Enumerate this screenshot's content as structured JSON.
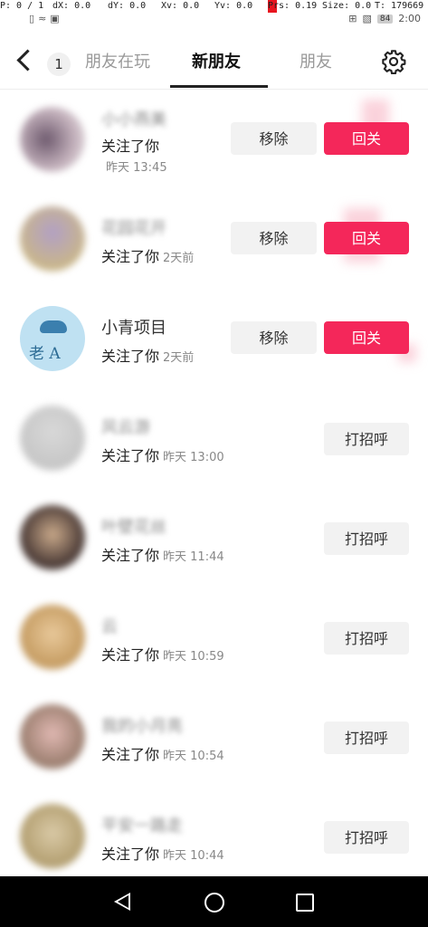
{
  "debug": {
    "p": "P: 0 / 1",
    "dx": "dX: 0.0",
    "dy": "dY: 0.0",
    "xv": "Xv: 0.0",
    "yv": "Yv: 0.0",
    "prs": "Prs: 0.19",
    "size": "Size: 0.0",
    "t": "T: 179669"
  },
  "statusbar": {
    "battery": "84",
    "time": "2:00"
  },
  "header": {
    "count": "1",
    "tabs": [
      "朋友在玩",
      "新朋友",
      "朋友"
    ],
    "active_tab": "新朋友"
  },
  "rows": [
    {
      "name": "小小燕美",
      "action": "关注了你",
      "time": "昨天 13:45",
      "buttons": [
        "移除",
        "回关"
      ]
    },
    {
      "name": "花园花开",
      "action": "关注了你",
      "time": "2天前",
      "buttons": [
        "移除",
        "回关"
      ]
    },
    {
      "name": "小青项目",
      "action": "关注了你",
      "time": "2天前",
      "buttons": [
        "移除",
        "回关"
      ]
    },
    {
      "name": "风云游",
      "action": "关注了你",
      "time": "昨天 13:00",
      "buttons": [
        "打招呼"
      ]
    },
    {
      "name": "叶壁花丝",
      "action": "关注了你",
      "time": "昨天 11:44",
      "buttons": [
        "打招呼"
      ]
    },
    {
      "name": "云",
      "action": "关注了你",
      "time": "昨天 10:59",
      "buttons": [
        "打招呼"
      ]
    },
    {
      "name": "我的小月亮",
      "action": "关注了你",
      "time": "昨天 10:54",
      "buttons": [
        "打招呼"
      ]
    },
    {
      "name": "平安一路走",
      "action": "关注了你",
      "time": "昨天 10:44",
      "buttons": [
        "打招呼"
      ]
    }
  ],
  "colors": {
    "accent": "#f4275a",
    "button_bg": "#f2f2f2"
  },
  "avatar3_text": "老 A"
}
